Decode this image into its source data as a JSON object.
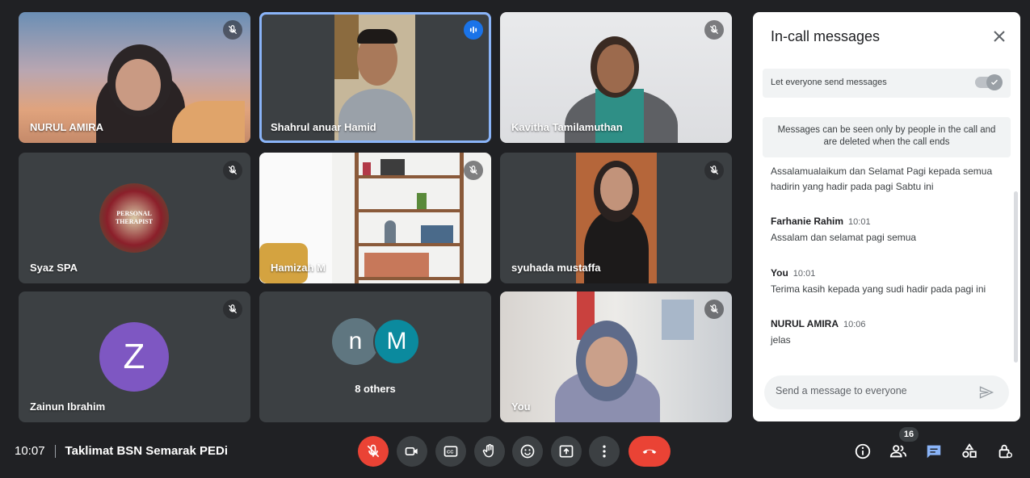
{
  "participants": [
    {
      "name": "NURUL AMIRA",
      "muted": true
    },
    {
      "name": "Shahrul anuar Hamid",
      "muted": false,
      "speaking": true
    },
    {
      "name": "Kavitha Tamilamuthan",
      "muted": true
    },
    {
      "name": "Syaz SPA",
      "muted": true,
      "avatar_text": "PERSONAL THERAPIST"
    },
    {
      "name": "Hamizah M",
      "muted": true
    },
    {
      "name": "syuhada mustaffa",
      "muted": true
    },
    {
      "name": "Zainun Ibrahim",
      "muted": true,
      "avatar_letter": "Z",
      "avatar_color": "#7e57c2"
    },
    {
      "name": "8 others",
      "avatars": [
        {
          "letter": "n",
          "color": "#5f7680"
        },
        {
          "letter": "M",
          "color": "#0b8a9e"
        }
      ]
    },
    {
      "name": "You",
      "muted": true
    }
  ],
  "meeting": {
    "time": "10:07",
    "title": "Taklimat BSN Semarak PEDi"
  },
  "controls": {
    "mic": "mic-off-icon",
    "camera": "camera-icon",
    "captions": "captions-icon",
    "raise_hand": "hand-icon",
    "emoji": "emoji-icon",
    "present": "present-icon",
    "more": "more-icon",
    "end_call": "end-call-icon"
  },
  "right_controls": {
    "people_count": "16"
  },
  "chat": {
    "title": "In-call messages",
    "toggle_label": "Let everyone send messages",
    "notice": "Messages can be seen only by people in the call and are deleted when the call ends",
    "messages": [
      {
        "sender": "",
        "time": "",
        "text": "Assalamualaikum dan Selamat Pagi kepada semua hadirin yang hadir pada pagi Sabtu ini"
      },
      {
        "sender": "Farhanie Rahim",
        "time": "10:01",
        "text": "Assalam dan selamat pagi semua"
      },
      {
        "sender": "You",
        "time": "10:01",
        "text": "Terima kasih kepada yang sudi hadir pada pagi ini"
      },
      {
        "sender": "NURUL AMIRA",
        "time": "10:06",
        "text": "jelas"
      }
    ],
    "input_placeholder": "Send a message to everyone"
  },
  "colors": {
    "background": "#202124",
    "tile": "#3c4043",
    "end_call": "#ea4335",
    "active_outline": "#8ab4f8",
    "chat_icon": "#8ab4f8"
  }
}
